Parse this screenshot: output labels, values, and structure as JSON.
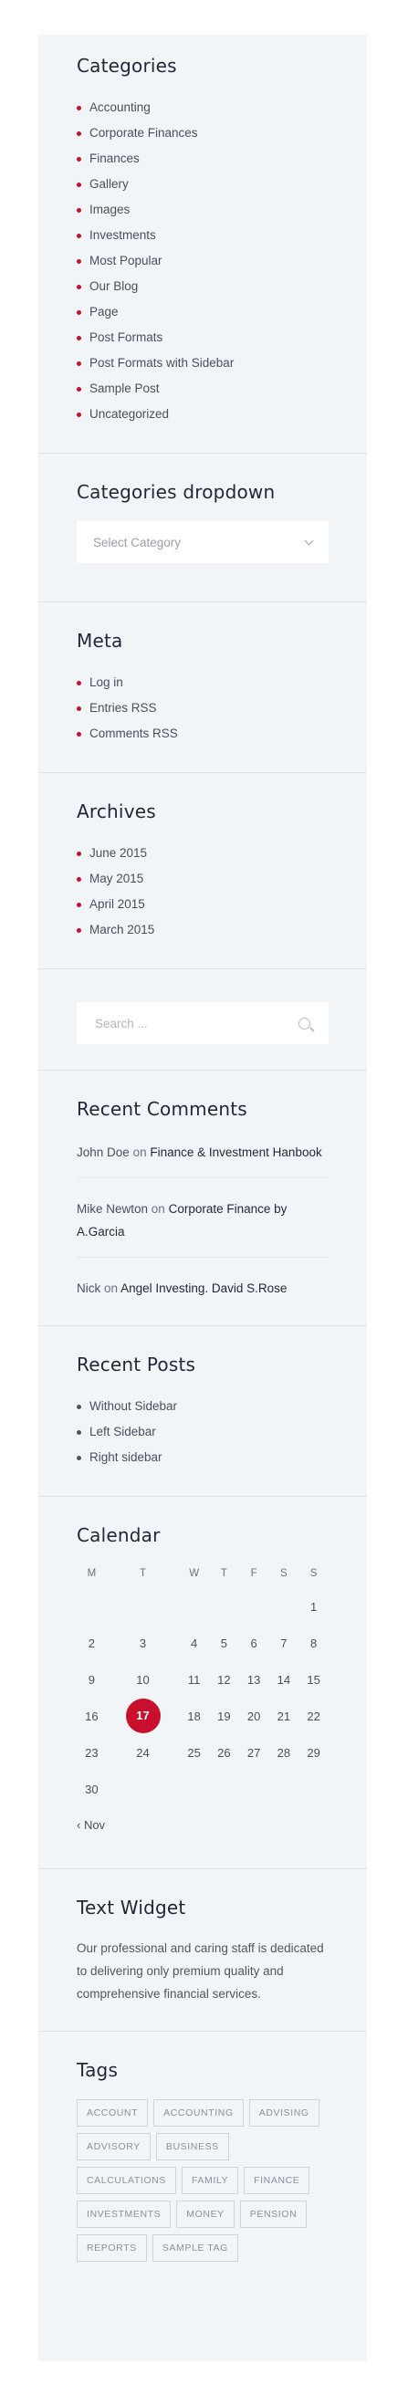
{
  "categories": {
    "title": "Categories",
    "items": [
      "Accounting",
      "Corporate Finances",
      "Finances",
      "Gallery",
      "Images",
      "Investments",
      "Most Popular",
      "Our Blog",
      "Page",
      "Post Formats",
      "Post Formats with Sidebar",
      "Sample Post",
      "Uncategorized"
    ]
  },
  "categories_dropdown": {
    "title": "Categories dropdown",
    "selected": "Select Category"
  },
  "meta": {
    "title": "Meta",
    "items": [
      "Log in",
      "Entries RSS",
      "Comments RSS"
    ]
  },
  "archives": {
    "title": "Archives",
    "items": [
      "June 2015",
      "May 2015",
      "April 2015",
      "March 2015"
    ]
  },
  "search": {
    "placeholder": "Search ..."
  },
  "recent_comments": {
    "title": "Recent Comments",
    "items": [
      {
        "author": "John Doe",
        "on": "on",
        "post": "Finance & Investment Hanbook"
      },
      {
        "author": "Mike Newton",
        "on": "on",
        "post": "Corporate Finance by A.Garcia"
      },
      {
        "author": "Nick",
        "on": "on",
        "post": "Angel Investing. David S.Rose"
      }
    ]
  },
  "recent_posts": {
    "title": "Recent Posts",
    "items": [
      "Without Sidebar",
      "Left Sidebar",
      "Right sidebar"
    ]
  },
  "calendar": {
    "title": "Calendar",
    "weekdays": [
      "M",
      "T",
      "W",
      "T",
      "F",
      "S",
      "S"
    ],
    "weeks": [
      [
        "",
        "",
        "",
        "",
        "",
        "",
        "1"
      ],
      [
        "2",
        "3",
        "4",
        "5",
        "6",
        "7",
        "8"
      ],
      [
        "9",
        "10",
        "11",
        "12",
        "13",
        "14",
        "15"
      ],
      [
        "16",
        "17",
        "18",
        "19",
        "20",
        "21",
        "22"
      ],
      [
        "23",
        "24",
        "25",
        "26",
        "27",
        "28",
        "29"
      ],
      [
        "30",
        "",
        "",
        "",
        "",
        "",
        ""
      ]
    ],
    "today": "17",
    "prev_label": "‹ Nov"
  },
  "text_widget": {
    "title": "Text Widget",
    "body": "Our professional and caring staff is dedicated to delivering only premium quality and comprehensive financial services."
  },
  "tags": {
    "title": "Tags",
    "items": [
      "ACCOUNT",
      "ACCOUNTING",
      "ADVISING",
      "ADVISORY",
      "BUSINESS",
      "CALCULATIONS",
      "FAMILY",
      "FINANCE",
      "INVESTMENTS",
      "MONEY",
      "PENSION",
      "REPORTS",
      "SAMPLE TAG"
    ]
  },
  "colors": {
    "accent": "#c8102e",
    "panel": "#f2f5f8",
    "divider": "#dde2e8"
  }
}
